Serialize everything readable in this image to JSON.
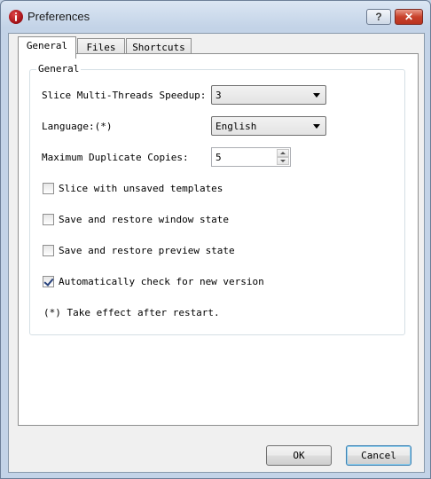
{
  "window": {
    "title": "Preferences",
    "help_label": "?",
    "close_label": "✕"
  },
  "tabs": [
    {
      "label": "General",
      "active": true
    },
    {
      "label": "Files",
      "active": false
    },
    {
      "label": "Shortcuts",
      "active": false
    }
  ],
  "general_group": {
    "title": "General",
    "slice_threads": {
      "label": "Slice Multi-Threads Speedup:",
      "value": "3"
    },
    "language": {
      "label": "Language:(*)",
      "value": "English"
    },
    "max_copies": {
      "label": "Maximum Duplicate Copies:",
      "value": "5"
    },
    "checkboxes": [
      {
        "label": "Slice with unsaved templates",
        "checked": false
      },
      {
        "label": "Save and restore window state",
        "checked": false
      },
      {
        "label": "Save and restore preview state",
        "checked": false
      },
      {
        "label": "Automatically check for new version",
        "checked": true
      }
    ],
    "note": "(*) Take effect after restart."
  },
  "buttons": {
    "ok": "OK",
    "cancel": "Cancel"
  }
}
